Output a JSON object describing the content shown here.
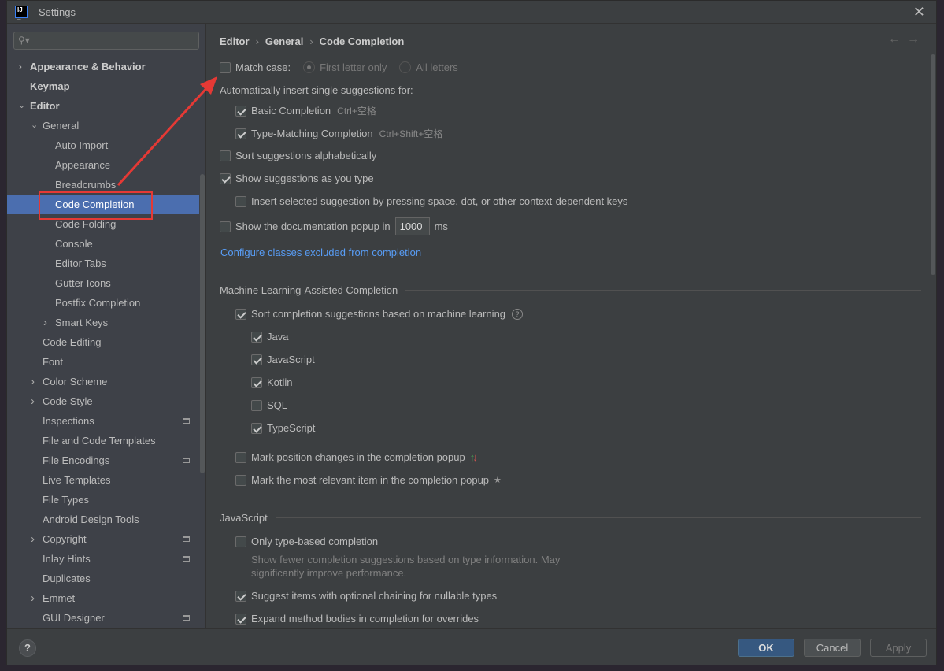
{
  "window": {
    "title": "Settings",
    "logo_text": "IJ"
  },
  "sidebar": {
    "search_placeholder": "",
    "items": [
      {
        "label": "Appearance & Behavior",
        "level": 0,
        "expand": "collapsed",
        "bold": true
      },
      {
        "label": "Keymap",
        "level": 0,
        "bold": true
      },
      {
        "label": "Editor",
        "level": 0,
        "expand": "expanded",
        "bold": true
      },
      {
        "label": "General",
        "level": 1,
        "expand": "expanded"
      },
      {
        "label": "Auto Import",
        "level": 2
      },
      {
        "label": "Appearance",
        "level": 2
      },
      {
        "label": "Breadcrumbs",
        "level": 2
      },
      {
        "label": "Code Completion",
        "level": 2,
        "selected": true
      },
      {
        "label": "Code Folding",
        "level": 2
      },
      {
        "label": "Console",
        "level": 2
      },
      {
        "label": "Editor Tabs",
        "level": 2
      },
      {
        "label": "Gutter Icons",
        "level": 2
      },
      {
        "label": "Postfix Completion",
        "level": 2
      },
      {
        "label": "Smart Keys",
        "level": 2,
        "expand": "collapsed"
      },
      {
        "label": "Code Editing",
        "level": 1
      },
      {
        "label": "Font",
        "level": 1
      },
      {
        "label": "Color Scheme",
        "level": 1,
        "expand": "collapsed"
      },
      {
        "label": "Code Style",
        "level": 1,
        "expand": "collapsed"
      },
      {
        "label": "Inspections",
        "level": 1,
        "project": true
      },
      {
        "label": "File and Code Templates",
        "level": 1
      },
      {
        "label": "File Encodings",
        "level": 1,
        "project": true
      },
      {
        "label": "Live Templates",
        "level": 1
      },
      {
        "label": "File Types",
        "level": 1
      },
      {
        "label": "Android Design Tools",
        "level": 1
      },
      {
        "label": "Copyright",
        "level": 1,
        "expand": "collapsed",
        "project": true
      },
      {
        "label": "Inlay Hints",
        "level": 1,
        "project": true
      },
      {
        "label": "Duplicates",
        "level": 1
      },
      {
        "label": "Emmet",
        "level": 1,
        "expand": "collapsed"
      },
      {
        "label": "GUI Designer",
        "level": 1,
        "project": true
      }
    ]
  },
  "breadcrumb": [
    "Editor",
    "General",
    "Code Completion"
  ],
  "main": {
    "match_case": {
      "label": "Match case:",
      "checked": false,
      "options": [
        "First letter only",
        "All letters"
      ],
      "selected": "First letter only"
    },
    "auto_insert_label": "Automatically insert single suggestions for:",
    "basic": {
      "label": "Basic Completion",
      "shortcut": "Ctrl+空格",
      "checked": true
    },
    "type_matching": {
      "label": "Type-Matching Completion",
      "shortcut": "Ctrl+Shift+空格",
      "checked": true
    },
    "sort_alpha": {
      "label": "Sort suggestions alphabetically",
      "checked": false
    },
    "show_as_type": {
      "label": "Show suggestions as you type",
      "checked": true
    },
    "insert_selected": {
      "label": "Insert selected suggestion by pressing space, dot, or other context-dependent keys",
      "checked": false
    },
    "doc_popup": {
      "label": "Show the documentation popup in",
      "value": "1000",
      "unit": "ms",
      "checked": false
    },
    "configure_link": "Configure classes excluded from completion",
    "ml_section": "Machine Learning-Assisted Completion",
    "ml_sort": {
      "label": "Sort completion suggestions based on machine learning",
      "checked": true
    },
    "ml_languages": [
      {
        "label": "Java",
        "checked": true
      },
      {
        "label": "JavaScript",
        "checked": true
      },
      {
        "label": "Kotlin",
        "checked": true
      },
      {
        "label": "SQL",
        "checked": false
      },
      {
        "label": "TypeScript",
        "checked": true
      }
    ],
    "mark_position": {
      "label": "Mark position changes in the completion popup",
      "checked": false
    },
    "mark_relevant": {
      "label": "Mark the most relevant item in the completion popup",
      "checked": false
    },
    "js_section": "JavaScript",
    "js_type_based": {
      "label": "Only type-based completion",
      "checked": false,
      "note": "Show fewer completion suggestions based on type information. May significantly improve performance."
    },
    "js_optional_chaining": {
      "label": "Suggest items with optional chaining for nullable types",
      "checked": true
    },
    "js_expand_bodies": {
      "label": "Expand method bodies in completion for overrides",
      "checked": true
    }
  },
  "footer": {
    "help": "?",
    "ok": "OK",
    "cancel": "Cancel",
    "apply": "Apply"
  },
  "colors": {
    "selection": "#4b6eaf",
    "ok_button": "#365880",
    "link": "#589df6",
    "annotation": "#e53935"
  }
}
